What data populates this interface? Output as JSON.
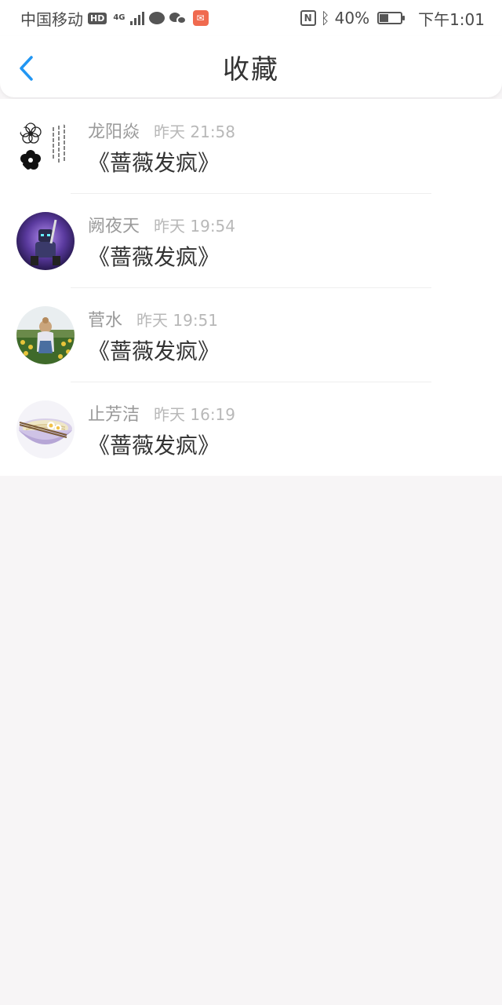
{
  "statusbar": {
    "carrier": "中国移动",
    "hd_badge": "HD",
    "network": "4G",
    "battery": "40%",
    "time": "下午1:01"
  },
  "header": {
    "title": "收藏",
    "back_icon": "chevron-left-icon",
    "accent_color": "#2196f3"
  },
  "favorites": [
    {
      "user": "龙阳焱",
      "time": "昨天 21:58",
      "title": "《蔷薇发疯》",
      "avatar": "flower-text-avatar",
      "avatar_text": "我们的过去·不可以不过去"
    },
    {
      "user": "阙夜天",
      "time": "昨天 19:54",
      "title": "《蔷薇发疯》",
      "avatar": "robot-avatar"
    },
    {
      "user": "菅水",
      "time": "昨天 19:51",
      "title": "《蔷薇发疯》",
      "avatar": "girl-field-avatar"
    },
    {
      "user": "止芳洁",
      "time": "昨天 16:19",
      "title": "《蔷薇发疯》",
      "avatar": "noodle-bowl-avatar"
    }
  ]
}
